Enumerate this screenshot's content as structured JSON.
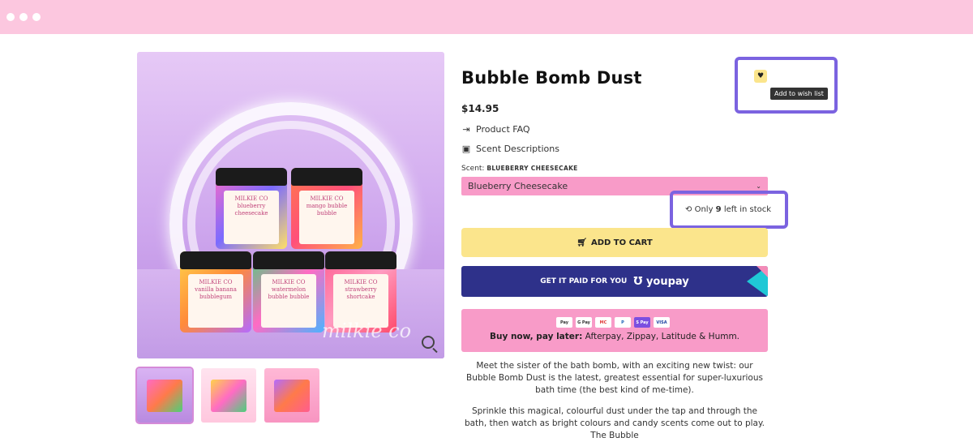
{
  "product": {
    "title": "Bubble Bomb Dust",
    "price": "$14.95",
    "faq_link": "Product FAQ",
    "scent_link": "Scent Descriptions",
    "scent_label": "Scent:",
    "scent_value": "BLUEBERRY CHEESECAKE",
    "scent_selected": "Blueberry Cheesecake",
    "stock_prefix": "Only",
    "stock_count": "9",
    "stock_suffix": "left in stock",
    "add_to_cart": "ADD TO CART",
    "youpay_text": "GET IT PAID FOR YOU",
    "youpay_logo": "youpay",
    "paylater_bold": "Buy now, pay later:",
    "paylater_rest": " Afterpay, Zippay, Latitude & Humm.",
    "payment_cards": [
      "Pay",
      "G Pay",
      "MC",
      "P",
      "S Pay",
      "VISA"
    ],
    "description_1": "Meet the sister of the bath bomb, with an exciting new twist: our Bubble Bomb Dust is the latest, greatest essential for super-luxurious bath time (the best kind of me-time).",
    "description_2": "Sprinkle this magical, colourful dust under the tap and through the bath, then watch as bright colours and candy scents come out to play. The Bubble",
    "wishlist_tooltip": "Add to wish list"
  },
  "image": {
    "watermark": "milkie co",
    "jar_brand": "MILKIE CO",
    "jar_labels": [
      "blueberry cheesecake",
      "mango bubble bubble",
      "vanilla banana bubblegum",
      "watermelon bubble bubble",
      "strawberry shortcake"
    ]
  },
  "colors": {
    "topbar": "#fcc7df",
    "accent_pink": "#f89bc8",
    "accent_yellow": "#fbe58c",
    "youpay_blue": "#2e318a",
    "callout": "#7b63e0"
  },
  "icons": [
    "browser-dot-icon",
    "zoom-icon",
    "faq-icon",
    "scent-icon",
    "chevron-down-icon",
    "stock-icon",
    "cart-icon",
    "youpay-icon",
    "heart-icon"
  ]
}
